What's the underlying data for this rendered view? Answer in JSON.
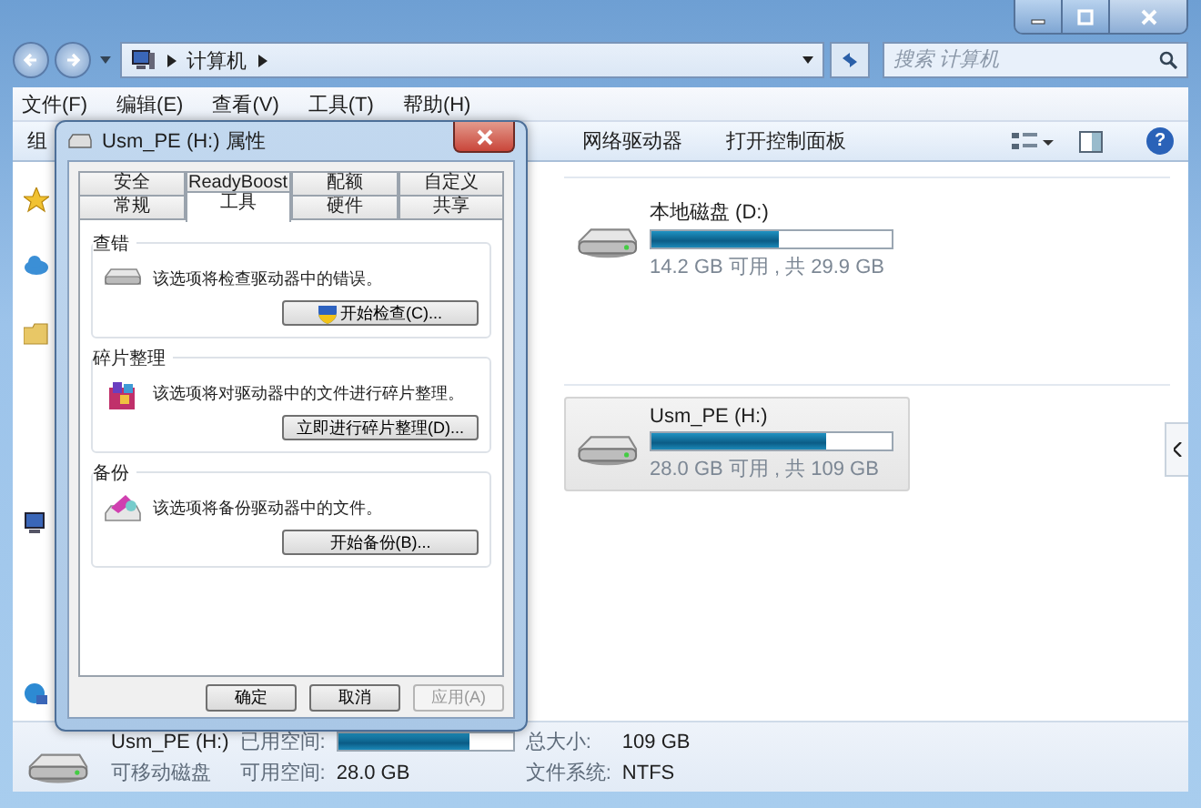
{
  "window": {
    "crumbs": [
      "计算机"
    ],
    "search": {
      "placeholder": "搜索 计算机"
    },
    "help": "?",
    "menu": [
      "文件(F)",
      "编辑(E)",
      "查看(V)",
      "工具(T)",
      "帮助(H)"
    ],
    "toolbar": [
      "组",
      "网络驱动器",
      "打开控制面板"
    ],
    "drives": [
      {
        "name": "本地磁盘 (D:)",
        "level": 0.53,
        "info": "14.2 GB 可用 , 共 29.9 GB",
        "selected": false
      },
      {
        "name": "Usm_PE (H:)",
        "level": 0.73,
        "info": "28.0 GB 可用 , 共 109 GB",
        "selected": true
      }
    ],
    "details": {
      "name": "Usm_PE (H:)",
      "type": "可移动磁盘",
      "used_label": "已用空间:",
      "level": 0.75,
      "free_label": "可用空间:",
      "free": "28.0 GB",
      "total_label": "总大小:",
      "total": "109 GB",
      "fs_label": "文件系统:",
      "fs": "NTFS"
    }
  },
  "dialog": {
    "title": "Usm_PE (H:) 属性",
    "tab_rows": [
      [
        {
          "label": "安全",
          "selected": false
        },
        {
          "label": "ReadyBoost",
          "selected": false
        },
        {
          "label": "配额",
          "selected": false
        },
        {
          "label": "自定义",
          "selected": false
        }
      ],
      [
        {
          "label": "常规",
          "selected": false
        },
        {
          "label": "工具",
          "selected": true
        },
        {
          "label": "硬件",
          "selected": false
        },
        {
          "label": "共享",
          "selected": false
        }
      ]
    ],
    "groups": [
      {
        "title": "查错",
        "kind": "drive",
        "text": "该选项将检查驱动器中的错误。",
        "button": "开始检查(C)...",
        "shield": true
      },
      {
        "title": "碎片整理",
        "kind": "defrag",
        "text": "该选项将对驱动器中的文件进行碎片整理。",
        "button": "立即进行碎片整理(D)...",
        "shield": false
      },
      {
        "title": "备份",
        "kind": "backup",
        "text": "该选项将备份驱动器中的文件。",
        "button": "开始备份(B)...",
        "shield": false
      }
    ],
    "buttons": [
      {
        "label": "确定",
        "disabled": false
      },
      {
        "label": "取消",
        "disabled": false
      },
      {
        "label": "应用(A)",
        "disabled": true
      }
    ]
  }
}
